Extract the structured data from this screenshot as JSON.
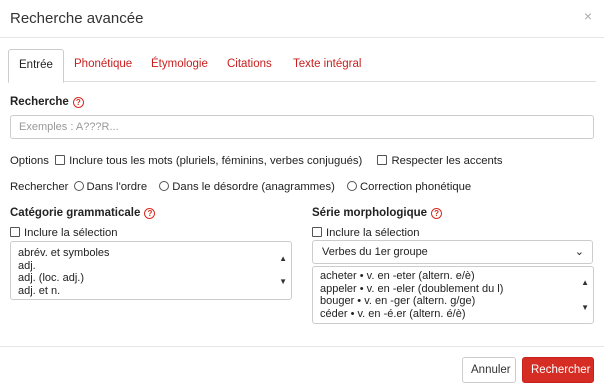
{
  "dialog": {
    "title": "Recherche avancée",
    "close_glyph": "×"
  },
  "tabs": [
    {
      "label": "Entrée"
    },
    {
      "label": "Phonétique"
    },
    {
      "label": "Étymologie"
    },
    {
      "label": "Citations"
    },
    {
      "label": "Texte intégral"
    }
  ],
  "active_tab": "Entrée",
  "search": {
    "label": "Recherche",
    "placeholder": "Exemples : A???R...",
    "value": ""
  },
  "options": {
    "label": "Options",
    "include_all": {
      "label": "Inclure tous les mots (pluriels, féminins, verbes conjugués)",
      "checked": false
    },
    "accents": {
      "label": "Respecter les accents",
      "checked": false
    }
  },
  "rechercher": {
    "label": "Rechercher",
    "choices": [
      {
        "label": "Dans l'ordre",
        "selected": false
      },
      {
        "label": "Dans le désordre (anagrammes)",
        "selected": false
      },
      {
        "label": "Correction phonétique",
        "selected": false
      }
    ]
  },
  "categorie": {
    "label": "Catégorie grammaticale",
    "include": {
      "label": "Inclure la sélection",
      "checked": false
    },
    "items": [
      "abrév. et symboles",
      "adj.",
      "adj. (loc. adj.)",
      "adj. et n."
    ]
  },
  "serie": {
    "label": "Série morphologique",
    "include": {
      "label": "Inclure la sélection",
      "checked": false
    },
    "selected": "Verbes du 1er groupe",
    "items": [
      "acheter • v. en -eter (altern. e/è)",
      "appeler • v. en -eler (doublement du l)",
      "bouger • v. en -ger (altern. g/ge)",
      "céder • v. en -é.er (altern. é/è)"
    ]
  },
  "footer": {
    "cancel_label": "Annuler",
    "submit_label": "Rechercher"
  },
  "colors": {
    "accent": "#d52d24",
    "tab_link": "#c8201f",
    "border": "#cccccc"
  },
  "icons": [
    "close-icon",
    "help-icon",
    "chevron-down-icon",
    "scroll-up-icon",
    "scroll-down-icon"
  ]
}
